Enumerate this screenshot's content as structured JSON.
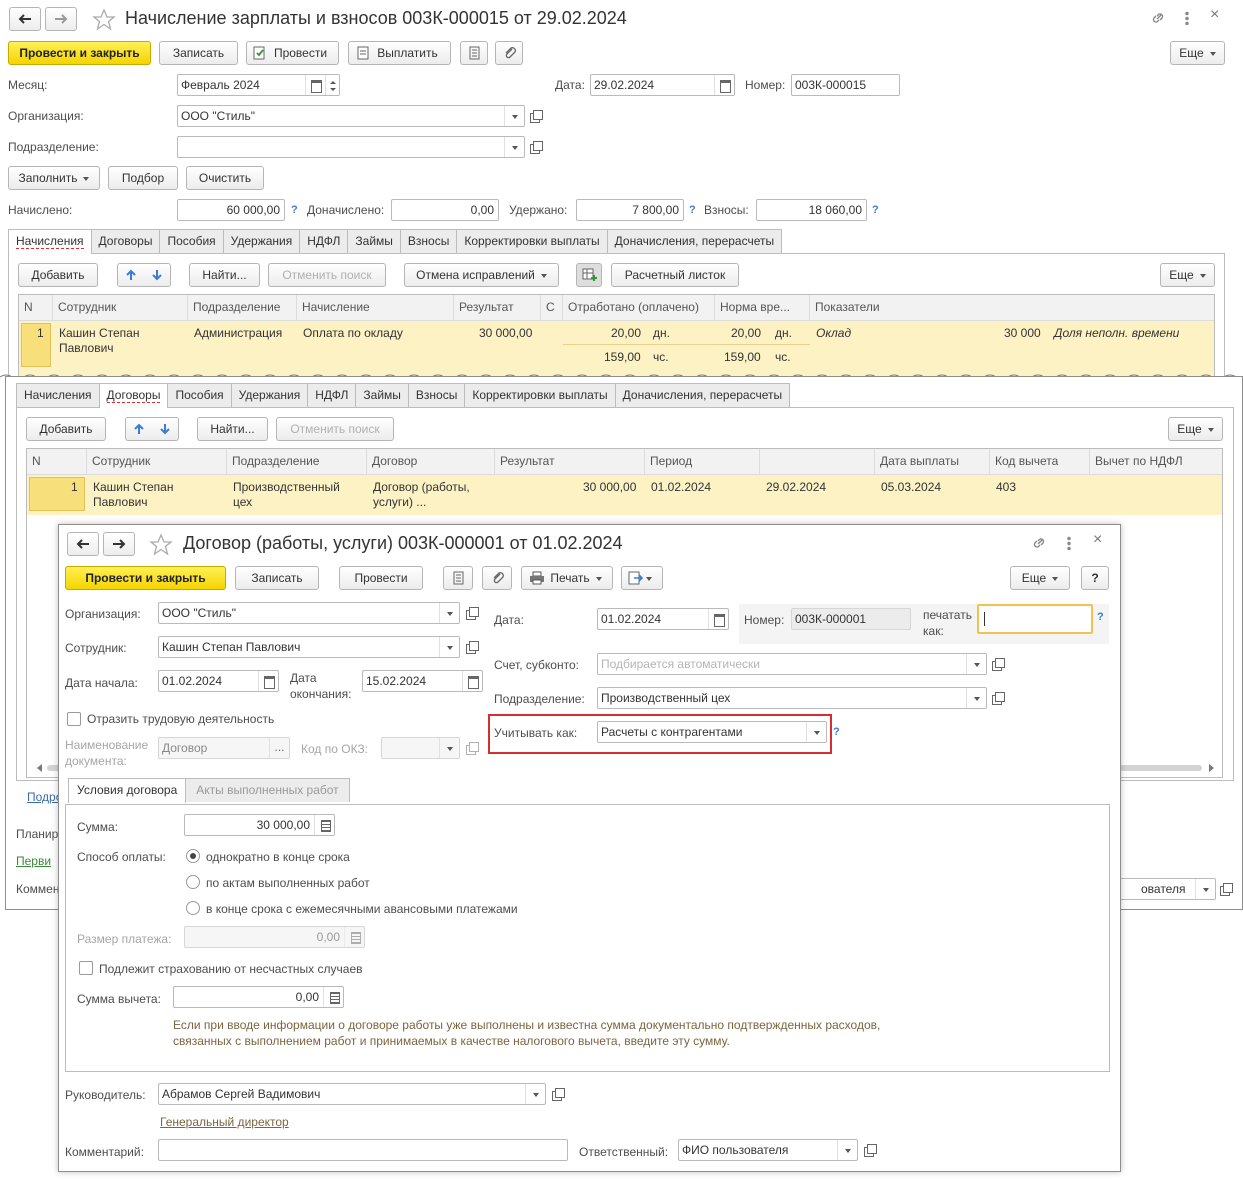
{
  "back": {
    "title": "Начисление зарплаты и взносов 003К-000015 от 29.02.2024",
    "toolbar": {
      "post_close": "Провести и закрыть",
      "save": "Записать",
      "post": "Провести",
      "pay": "Выплатить",
      "more": "Еще"
    },
    "fields": {
      "month_label": "Месяц:",
      "month_value": "Февраль 2024",
      "date_label": "Дата:",
      "date_value": "29.02.2024",
      "number_label": "Номер:",
      "number_value": "003К-000015",
      "org_label": "Организация:",
      "org_value": "ООО \"Стиль\"",
      "dept_label": "Подразделение:",
      "dept_value": ""
    },
    "actions": {
      "fill": "Заполнить",
      "select": "Подбор",
      "clear": "Очистить"
    },
    "totals": {
      "accrued_label": "Начислено:",
      "accrued_value": "60 000,00",
      "extra_label": "Доначислено:",
      "extra_value": "0,00",
      "withheld_label": "Удержано:",
      "withheld_value": "7 800,00",
      "contrib_label": "Взносы:",
      "contrib_value": "18 060,00"
    },
    "tabs": [
      "Начисления",
      "Договоры",
      "Пособия",
      "Удержания",
      "НДФЛ",
      "Займы",
      "Взносы",
      "Корректировки выплаты",
      "Доначисления, перерасчеты"
    ],
    "grid_toolbar": {
      "add": "Добавить",
      "find": "Найти...",
      "cancel_search": "Отменить поиск",
      "cancel_fix": "Отмена исправлений",
      "payslip": "Расчетный листок",
      "more": "Еще"
    },
    "grid": {
      "headers": [
        "N",
        "Сотрудник",
        "Подразделение",
        "Начисление",
        "Результат",
        "С",
        "Отработано (оплачено)",
        "Норма вре...",
        "Показатели"
      ],
      "row": {
        "n": "1",
        "employee_1": "Кашин Степан",
        "employee_2": "Павлович",
        "dept": "Администрация",
        "accrual": "Оплата по окладу",
        "result": "30 000,00",
        "worked_days": "20,00",
        "days_unit": "дн.",
        "worked_hours": "159,00",
        "hours_unit": "чс.",
        "norm_days": "20,00",
        "norm_days_unit": "дн.",
        "norm_hours": "159,00",
        "norm_hours_unit": "чс.",
        "ind_name": "Оклад",
        "ind_value": "30 000",
        "ind_name_2": "Доля неполн. времени"
      }
    }
  },
  "middle": {
    "tabs": [
      "Начисления",
      "Договоры",
      "Пособия",
      "Удержания",
      "НДФЛ",
      "Займы",
      "Взносы",
      "Корректировки выплаты",
      "Доначисления, перерасчеты"
    ],
    "grid_toolbar": {
      "add": "Добавить",
      "find": "Найти...",
      "cancel_search": "Отменить поиск",
      "more": "Еще"
    },
    "grid": {
      "headers": [
        "N",
        "Сотрудник",
        "Подразделение",
        "Договор",
        "Результат",
        "Период",
        "",
        "Дата выплаты",
        "Код вычета",
        "Вычет по НДФЛ"
      ],
      "row": {
        "n": "1",
        "employee_1": "Кашин Степан",
        "employee_2": "Павлович",
        "dept_1": "Производственный",
        "dept_2": "цех",
        "contract_1": "Договор (работы,",
        "contract_2": "услуги) ...",
        "result": "30 000,00",
        "period_from": "01.02.2024",
        "period_to": "29.02.2024",
        "pay_date": "05.03.2024",
        "deduct_code": "403"
      }
    },
    "below": {
      "link_partial": "Подро",
      "plan_partial": "Планир",
      "primary_partial": "Перви",
      "comment_partial": "Коммен",
      "resp_partial": "ователя"
    }
  },
  "front": {
    "title": "Договор (работы, услуги) 003К-000001 от 01.02.2024",
    "toolbar": {
      "post_close": "Провести и закрыть",
      "save": "Записать",
      "post": "Провести",
      "print": "Печать",
      "more": "Еще",
      "help": "?"
    },
    "fields": {
      "org_label": "Организация:",
      "org_value": "ООО \"Стиль\"",
      "emp_label": "Сотрудник:",
      "emp_value": "Кашин Степан Павлович",
      "start_label": "Дата начала:",
      "start_value": "01.02.2024",
      "end_label_1": "Дата",
      "end_label_2": "окончания:",
      "end_value": "15.02.2024",
      "labor_check": "Отразить трудовую деятельность",
      "docname_label_1": "Наименование",
      "docname_label_2": "документа:",
      "docname_value": "Договор",
      "okz_label": "Код по ОКЗ:",
      "date_label": "Дата:",
      "date_value": "01.02.2024",
      "number_label": "Номер:",
      "number_value": "003К-000001",
      "print_as_1": "печатать",
      "print_as_2": "как:",
      "account_label": "Счет, субконто:",
      "account_placeholder": "Подбирается автоматически",
      "dept_label": "Подразделение:",
      "dept_value": "Производственный цех",
      "account_as_label": "Учитывать как:",
      "account_as_value": "Расчеты с контрагентами"
    },
    "tabs": [
      "Условия договора",
      "Акты выполненных работ"
    ],
    "conditions": {
      "sum_label": "Сумма:",
      "sum_value": "30 000,00",
      "pay_label": "Способ оплаты:",
      "pay_options": [
        "однократно в конце срока",
        "по актам выполненных работ",
        "в конце срока с ежемесячными авансовыми платежами"
      ],
      "pay_size_label": "Размер платежа:",
      "pay_size_value": "0,00",
      "insurance_check": "Подлежит страхованию от несчастных случаев",
      "deduct_label": "Сумма вычета:",
      "deduct_value": "0,00",
      "hint": "Если при вводе информации о договоре работы уже выполнены и известна сумма документально подтвержденных расходов, связанных с выполнением работ и принимаемых в качестве налогового вычета, введите эту сумму."
    },
    "bottom": {
      "head_label": "Руководитель:",
      "head_value": "Абрамов Сергей Вадимович",
      "head_position": "Генеральный директор",
      "comment_label": "Комментарий:",
      "comment_value": "",
      "resp_label": "Ответственный:",
      "resp_value": "ФИО пользователя"
    }
  },
  "colors": {
    "accent_yellow": "#f5d400",
    "row_highlight": "#fdf2c4",
    "highlight_red": "#d92d2d",
    "focus_orange": "#f2c14e"
  }
}
